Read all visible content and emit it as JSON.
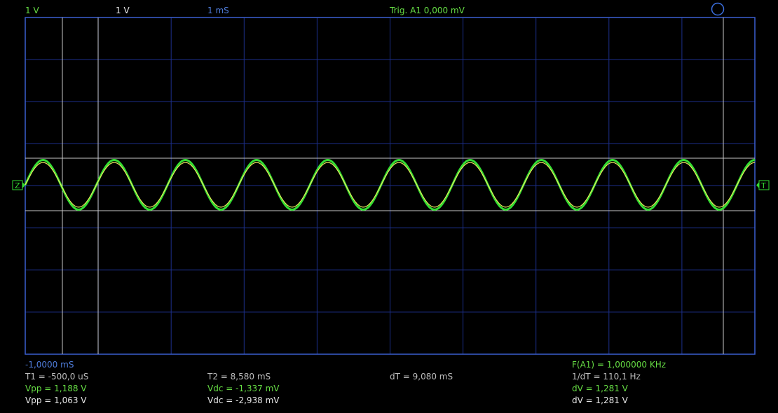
{
  "header": {
    "ch1_scale": "1 V",
    "ch2_scale": "1 V",
    "timebase": "1 mS",
    "trigger": "Trig. A1  0,000 mV"
  },
  "markers": {
    "left": "Z",
    "right": "T"
  },
  "readouts": {
    "time_offset": "-1,0000 mS",
    "t1": "T1 = -500,0 uS",
    "t2": "T2 = 8,580 mS",
    "dt": "dT = 9,080 mS",
    "freq": "F(A1) = 1,000000 KHz",
    "inv_dt": "1/dT = 110,1 Hz",
    "vpp_a": "Vpp = 1,188 V",
    "vdc_a": "Vdc = -1,337 mV",
    "dv_a": "dV = 1,281 V",
    "vpp_b": "Vpp = 1,063 V",
    "vdc_b": "Vdc = -2,938 mV",
    "dv_b": "dV = 1,281 V"
  },
  "colors": {
    "background": "#000000",
    "grid": "#1c2f8a",
    "frame": "#3b5fd0",
    "trace_a": "#33dd33",
    "trace_b": "#e6e65a",
    "cursor": "#c8c8c8",
    "label_green": "#66dd44"
  },
  "chart_data": {
    "type": "line",
    "x_divisions": 10,
    "y_divisions": 8,
    "series": [
      {
        "cycles": 10.25,
        "amplitude": 0.59
      },
      {
        "cycles": 10.25,
        "amplitude": 0.53
      }
    ]
  }
}
